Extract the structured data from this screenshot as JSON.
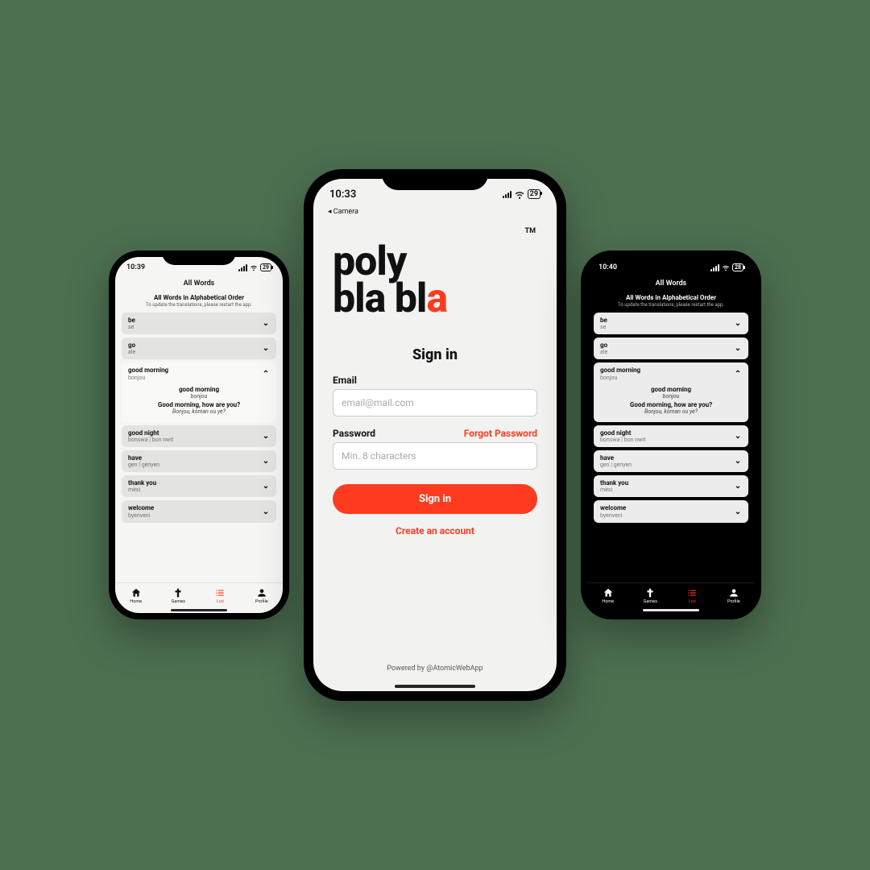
{
  "accent": "#ff3b1f",
  "status": {
    "time_l": "10:39",
    "time_c": "10:33",
    "time_r": "10:40",
    "battery": "29",
    "battery_r": "28",
    "camera_back": "◂ Camera"
  },
  "list": {
    "title": "All Words",
    "subtitle": "All Words in Alphabetical Order",
    "subtext": "To update the translations, please restart the app.",
    "items": [
      {
        "word": "be",
        "trans": "se"
      },
      {
        "word": "go",
        "trans": "ale"
      },
      {
        "word": "good morning",
        "trans": "bonjou",
        "expanded": true,
        "detail": [
          {
            "w": "good morning",
            "t": "bonjou"
          },
          {
            "w": "Good morning, how are you?",
            "t": "Bonjou, kòman ou ye?"
          }
        ]
      },
      {
        "word": "good night",
        "trans": "bonswa | bon nwit"
      },
      {
        "word": "have",
        "trans": "gen | genyen"
      },
      {
        "word": "thank you",
        "trans": "mèsi"
      },
      {
        "word": "welcome",
        "trans": "byenveni"
      }
    ]
  },
  "tabs": [
    {
      "label": "Home"
    },
    {
      "label": "Games"
    },
    {
      "label": "List",
      "active": true
    },
    {
      "label": "Profile"
    }
  ],
  "login": {
    "logo1": "poly",
    "logo2": "bla bl",
    "logo3": "a",
    "tm": "TM",
    "title": "Sign in",
    "email_label": "Email",
    "email_ph": "email@mail.com",
    "pass_label": "Password",
    "pass_ph": "Min. 8 characters",
    "forgot": "Forgot Password",
    "button": "Sign in",
    "create": "Create an account",
    "footer": "Powered by @AtomicWebApp"
  }
}
